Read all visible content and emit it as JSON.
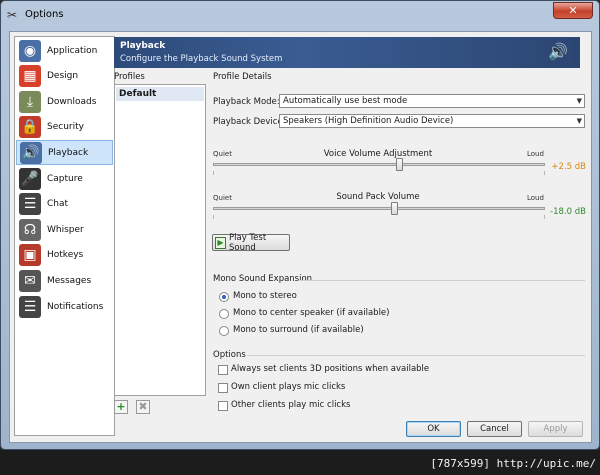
{
  "window": {
    "title": "Options",
    "close_label": "✕"
  },
  "sidebar": {
    "items": [
      {
        "label": "Application",
        "icon": "speaker-app-icon",
        "color": "#4a6fa5",
        "glyph": "◉"
      },
      {
        "label": "Design",
        "icon": "design-grid-icon",
        "color": "#d7402a",
        "glyph": "▦"
      },
      {
        "label": "Downloads",
        "icon": "downloads-icon",
        "color": "#7a8a5a",
        "glyph": "⤓"
      },
      {
        "label": "Security",
        "icon": "lock-icon",
        "color": "#c23b2a",
        "glyph": "🔒"
      },
      {
        "label": "Playback",
        "icon": "speaker-icon",
        "color": "#4a6fa5",
        "glyph": "🔊"
      },
      {
        "label": "Capture",
        "icon": "microphone-icon",
        "color": "#333333",
        "glyph": "🎤"
      },
      {
        "label": "Chat",
        "icon": "chat-icon",
        "color": "#444444",
        "glyph": "☰"
      },
      {
        "label": "Whisper",
        "icon": "headset-icon",
        "color": "#666666",
        "glyph": "☊"
      },
      {
        "label": "Hotkeys",
        "icon": "hotkeys-icon",
        "color": "#b53a2a",
        "glyph": "▣"
      },
      {
        "label": "Messages",
        "icon": "messages-icon",
        "color": "#555555",
        "glyph": "✉"
      },
      {
        "label": "Notifications",
        "icon": "notifications-icon",
        "color": "#444444",
        "glyph": "☰"
      }
    ],
    "selected": "Playback"
  },
  "header": {
    "title": "Playback",
    "subtitle": "Configure the Playback Sound System"
  },
  "profiles": {
    "label": "Profiles",
    "items": [
      "Default"
    ],
    "add_label": "+",
    "delete_label": "✖"
  },
  "details": {
    "label": "Profile Details",
    "playback_mode_label": "Playback Mode:",
    "playback_mode_value": "Automatically use best mode",
    "playback_device_label": "Playback Device:",
    "playback_device_value": "Speakers (High Definition Audio Device)",
    "voice_slider": {
      "min_label": "Quiet",
      "max_label": "Loud",
      "title": "Voice Volume Adjustment",
      "value": "+2.5 dB",
      "value_color": "#d8870c",
      "level": 0.56
    },
    "soundpack_slider": {
      "min_label": "Quiet",
      "max_label": "Loud",
      "title": "Sound Pack Volume",
      "value": "-18.0 dB",
      "value_color": "#2f8a2a",
      "level": 0.545
    },
    "play_test_label": "Play Test Sound"
  },
  "mono": {
    "label": "Mono Sound Expansion",
    "options": [
      "Mono to stereo",
      "Mono to center speaker (if available)",
      "Mono to surround (if available)"
    ],
    "selected_index": 0
  },
  "options": {
    "label": "Options",
    "checks": [
      {
        "label": "Always set clients 3D positions when available",
        "checked": false
      },
      {
        "label": "Own client plays mic clicks",
        "checked": false
      },
      {
        "label": "Other clients play mic clicks",
        "checked": false
      }
    ]
  },
  "buttons": {
    "ok": "OK",
    "cancel": "Cancel",
    "apply": "Apply"
  },
  "watermark": "[787x599] http://upic.me/"
}
